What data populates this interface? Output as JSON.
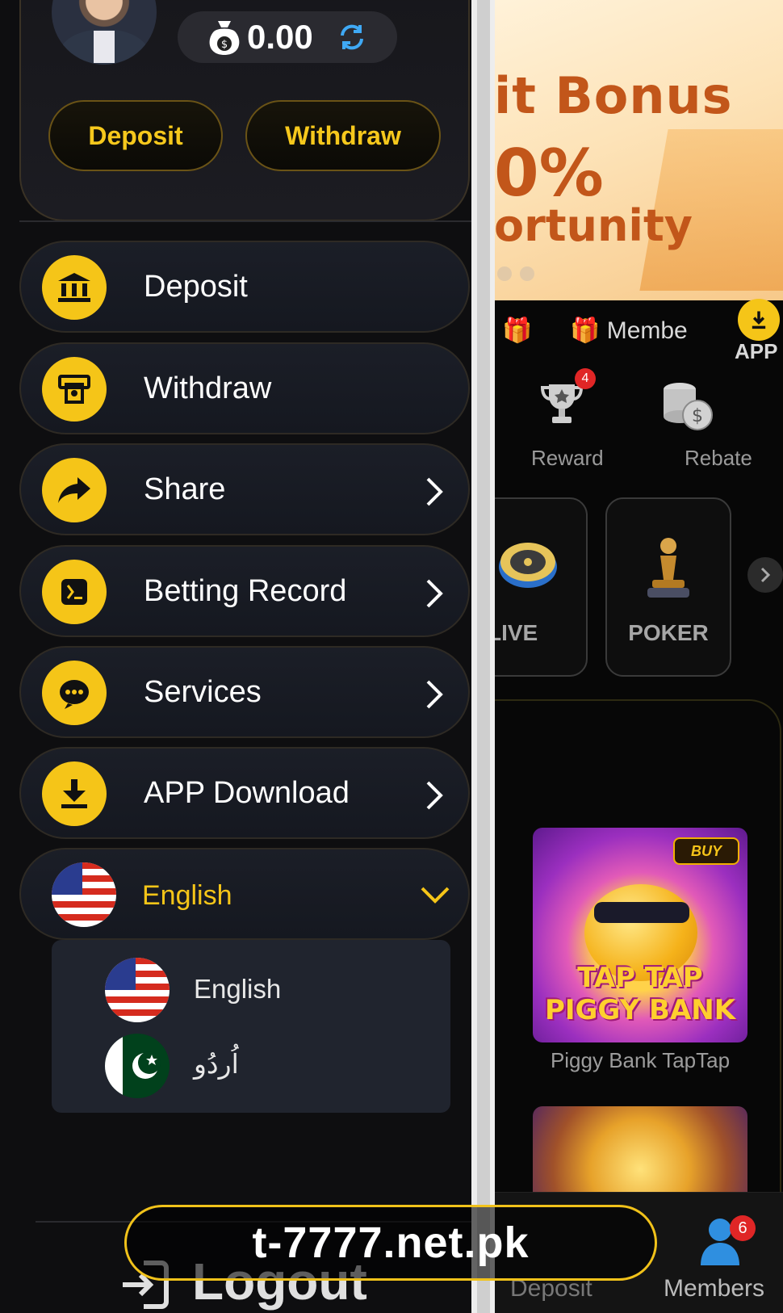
{
  "wallet": {
    "balance": "0.00"
  },
  "profile_buttons": {
    "deposit": "Deposit",
    "withdraw": "Withdraw"
  },
  "menu": {
    "items": [
      {
        "label": "Deposit",
        "icon": "bank-icon",
        "has_chevron": false
      },
      {
        "label": "Withdraw",
        "icon": "atm-icon",
        "has_chevron": false
      },
      {
        "label": "Share",
        "icon": "share-arrow-icon",
        "has_chevron": true
      },
      {
        "label": "Betting Record",
        "icon": "record-icon",
        "has_chevron": true
      },
      {
        "label": "Services",
        "icon": "headset-icon",
        "has_chevron": true
      },
      {
        "label": "APP Download",
        "icon": "download-icon",
        "has_chevron": true
      }
    ]
  },
  "language": {
    "selected": "English",
    "options": [
      {
        "label": "English",
        "flag": "us-flag-icon"
      },
      {
        "label": "اُردُو",
        "flag": "pakistan-flag-icon"
      }
    ]
  },
  "logout": {
    "label": "Logout"
  },
  "background_app": {
    "banner": {
      "line1": "it Bonus",
      "line2": "0%",
      "line3": "ortunity"
    },
    "tabs": {
      "member": "Membe",
      "app": "APP"
    },
    "shortcuts": [
      {
        "label": "Reward",
        "badge": "4"
      },
      {
        "label": "Rebate"
      }
    ],
    "categories": [
      "LIVE",
      "POKER"
    ],
    "games": [
      {
        "name": "Piggy Bank TapTap",
        "art_title": "TAP TAP PIGGY BANK",
        "tag": "BUY"
      }
    ],
    "bottom_nav": {
      "deposit": "Deposit",
      "members": "Members",
      "members_badge": "6"
    }
  },
  "watermark": {
    "text": "t-7777.net.pk"
  },
  "colors": {
    "accent": "#f5c518",
    "badge": "#e02626",
    "row_bg": "#1b1e27"
  }
}
